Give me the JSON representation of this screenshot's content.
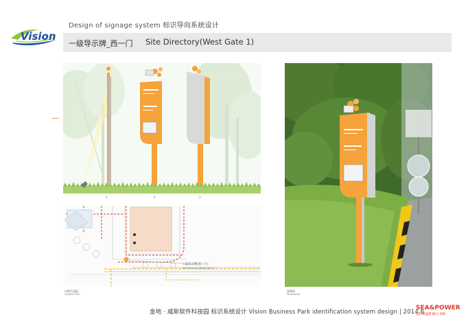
{
  "header": {
    "top_title": "Design of signage system  标识导向系统设计",
    "bar_cn": "一级导示牌_西一门",
    "bar_en": "Site Directory(West Gate 1)"
  },
  "logo": {
    "text": "Vision",
    "icon": "vision-swoosh-logo"
  },
  "elevation": {
    "captions": [
      "1",
      "2",
      "3"
    ]
  },
  "plan": {
    "label_cn": "二级导示牌(西一门)",
    "label_en": "Site Directory(West Gate 1)",
    "caption": "位置平面图",
    "caption_en": "Location Plan"
  },
  "photo": {
    "caption": "效果图",
    "caption_en": "Perspective"
  },
  "footer": {
    "text": "金地 · 威新软件科技园 标识系统设计  Vision Business Park  identification system design | 2014.6",
    "brand": "SEA&POWER",
    "brand_sub": "设计师品牌  四川  深圳"
  },
  "colors": {
    "accent": "#f5a33a",
    "header_bar": "#e9e9e9",
    "brand_red": "#e23b2a",
    "logo_blue": "#1d4fa0"
  }
}
